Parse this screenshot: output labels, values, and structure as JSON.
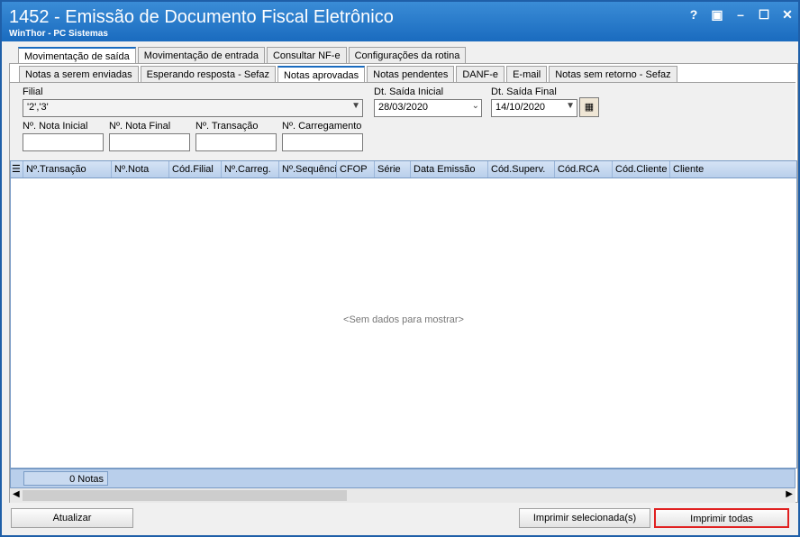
{
  "window": {
    "title": "1452 - Emissão de Documento Fiscal Eletrônico",
    "subtitle": "WinThor - PC Sistemas",
    "controls": [
      "?",
      "▣",
      "–",
      "☐",
      "✕"
    ]
  },
  "main_tabs": [
    "Movimentação de saída",
    "Movimentação de entrada",
    "Consultar NF-e",
    "Configurações da rotina"
  ],
  "sub_tabs": [
    "Notas a serem enviadas",
    "Esperando resposta - Sefaz",
    "Notas aprovadas",
    "Notas pendentes",
    "DANF-e",
    "E-mail",
    "Notas sem retorno - Sefaz"
  ],
  "filters": {
    "filial_label": "Filial",
    "filial_value": "'2','3'",
    "dt_inicial_label": "Dt. Saída Inicial",
    "dt_inicial_value": "28/03/2020",
    "dt_final_label": "Dt. Saída Final",
    "dt_final_value": "14/10/2020",
    "nota_inicial_label": "Nº. Nota Inicial",
    "nota_final_label": "Nº. Nota Final",
    "transacao_label": "Nº. Transação",
    "carregamento_label": "Nº. Carregamento"
  },
  "grid": {
    "columns": [
      "Nº.Transação",
      "Nº.Nota",
      "Cód.Filial",
      "Nº.Carreg.",
      "Nº.Sequência",
      "CFOP",
      "Série",
      "Data Emissão",
      "Cód.Superv.",
      "Cód.RCA",
      "Cód.Cliente",
      "Cliente"
    ],
    "empty_text": "<Sem dados para mostrar>",
    "count": "0 Notas"
  },
  "buttons": {
    "atualizar": "Atualizar",
    "imprimir_selecionada": "Imprimir selecionada(s)",
    "imprimir_todas": "Imprimir todas"
  },
  "colors": {
    "title_bar": "#1a6bbf",
    "grid_header": "#b9cfeb",
    "highlight": "#e02020"
  }
}
